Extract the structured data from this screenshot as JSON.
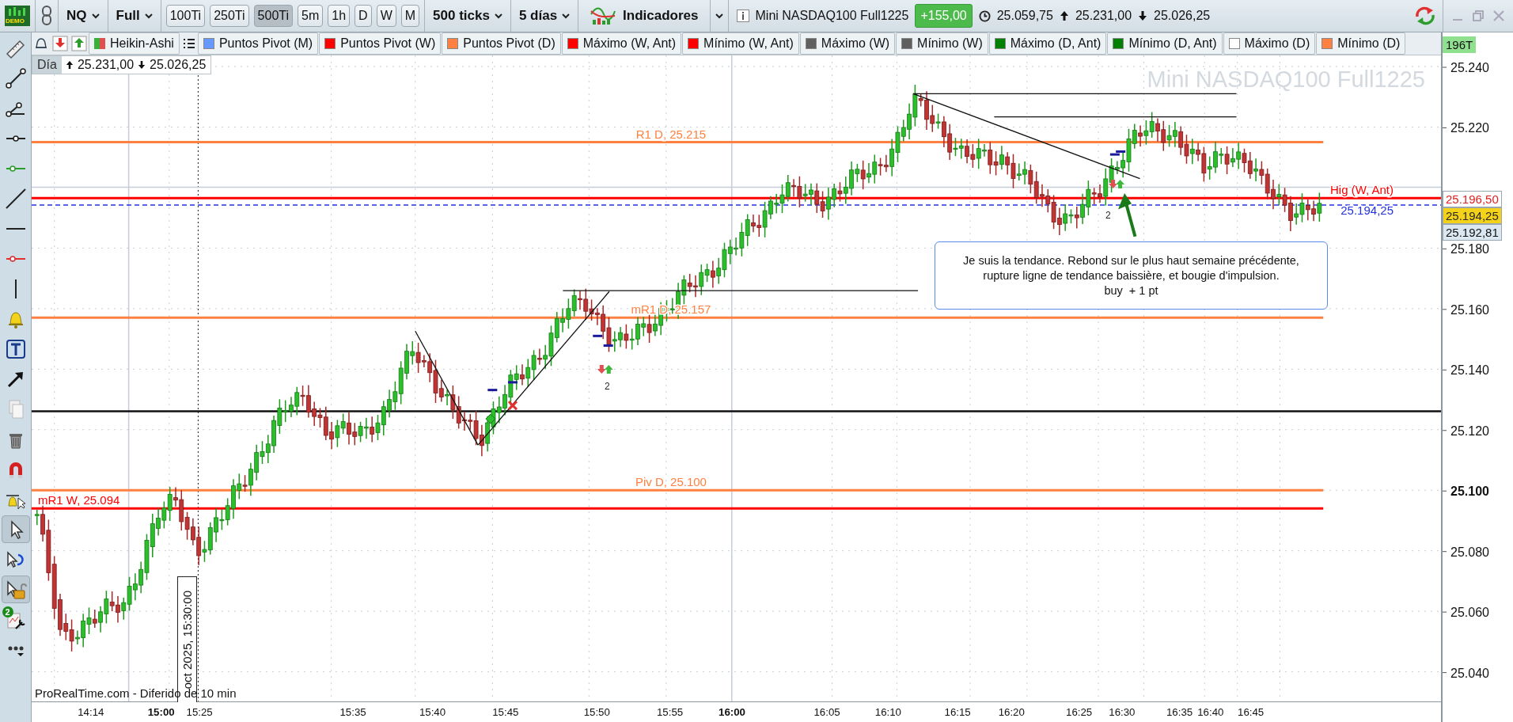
{
  "toolbar": {
    "logo": "DEMO",
    "symbol": "NQ",
    "mode": "Full",
    "intervals": [
      {
        "label": "100Ti",
        "selected": false
      },
      {
        "label": "250Ti",
        "selected": false
      },
      {
        "label": "500Ti",
        "selected": true
      },
      {
        "label": "5m",
        "selected": false
      },
      {
        "label": "1h",
        "selected": false
      },
      {
        "label": "D",
        "selected": false
      },
      {
        "label": "W",
        "selected": false
      },
      {
        "label": "M",
        "selected": false
      }
    ],
    "ticks": "500 ticks",
    "period": "5 días",
    "indicators": "Indicadores",
    "instrument": "Mini NASDAQ100 Full1225",
    "change": "+155,00",
    "last": "25.059,75",
    "high": "25.231,00",
    "low": "25.026,25"
  },
  "legend": {
    "items": [
      {
        "label": "Heikin-Ashi",
        "kind": "heikin"
      },
      {
        "label": "Puntos Pivot (M)",
        "kind": "swatch",
        "color": "#6699ff"
      },
      {
        "label": "Puntos Pivot (W)",
        "kind": "swatch",
        "color": "#ff0000"
      },
      {
        "label": "Puntos Pivot (D)",
        "kind": "swatch",
        "color": "#ff8040"
      },
      {
        "label": "Máximo (W, Ant)",
        "kind": "swatch",
        "color": "#ff0000"
      },
      {
        "label": "Mínimo (W, Ant)",
        "kind": "swatch",
        "color": "#ff0000"
      },
      {
        "label": "Máximo (W)",
        "kind": "swatch",
        "color": "#606060"
      },
      {
        "label": "Mínimo (W)",
        "kind": "swatch",
        "color": "#606060"
      },
      {
        "label": "Máximo (D, Ant)",
        "kind": "swatch",
        "color": "#008000"
      },
      {
        "label": "Mínimo (D, Ant)",
        "kind": "swatch",
        "color": "#008000"
      },
      {
        "label": "Máximo (D)",
        "kind": "swatch",
        "color": "#ffffff"
      },
      {
        "label": "Mínimo (D)",
        "kind": "swatch",
        "color": "#ff8040"
      }
    ],
    "bar_count": "196T"
  },
  "sidebar": {
    "tools": [
      {
        "kind": "ruler",
        "selected": false
      },
      {
        "kind": "segment",
        "selected": false
      },
      {
        "kind": "ray",
        "selected": false
      },
      {
        "kind": "hdot",
        "selected": false
      },
      {
        "kind": "hgreen",
        "selected": false
      },
      {
        "kind": "line",
        "selected": false
      },
      {
        "kind": "hline",
        "selected": false
      },
      {
        "kind": "hred",
        "selected": false
      },
      {
        "kind": "vline",
        "selected": false
      },
      {
        "kind": "bell",
        "selected": false
      },
      {
        "kind": "text",
        "selected": false
      },
      {
        "kind": "arrow",
        "selected": false
      },
      {
        "kind": "copy",
        "selected": false
      },
      {
        "kind": "trash",
        "selected": false
      },
      {
        "kind": "magnet",
        "selected": false
      },
      {
        "kind": "bellcursor",
        "selected": false
      },
      {
        "kind": "pointer",
        "selected": true
      },
      {
        "kind": "rotate",
        "selected": false
      },
      {
        "kind": "lock",
        "selected": true
      },
      {
        "kind": "wrench",
        "selected": false,
        "badge": "2"
      },
      {
        "kind": "more",
        "selected": false
      }
    ]
  },
  "chart": {
    "day_label": "Día",
    "day_high": "25.231,00",
    "day_low": "25.026,25",
    "watermark": "Mini NASDAQ100 Full1225",
    "levels": [
      {
        "label": "R1 D, 25.215",
        "color": "#ff8040",
        "kind": "pivot"
      },
      {
        "label": "Hig (W, Ant)",
        "color": "#ff0000",
        "kind": "high"
      },
      {
        "label": "25.194,25",
        "color": "#2233dd",
        "kind": "current"
      },
      {
        "label": "mR1 D, 25.157",
        "color": "#ff8040",
        "kind": "pivot"
      },
      {
        "label": "Piv D, 25.100",
        "color": "#ff8040",
        "kind": "pivot"
      },
      {
        "label": "mR1 W, 25.094",
        "color": "#ff0000",
        "kind": "weekly"
      }
    ],
    "price_tags": [
      {
        "label": "25.196,50",
        "kind": "high"
      },
      {
        "label": "25.194,25",
        "kind": "level"
      },
      {
        "label": "25.192,81",
        "kind": "last"
      }
    ],
    "yticks": [
      {
        "label": "25.240",
        "bold": false
      },
      {
        "label": "25.220",
        "bold": false
      },
      {
        "label": "25.180",
        "bold": false
      },
      {
        "label": "25.160",
        "bold": false
      },
      {
        "label": "25.140",
        "bold": false
      },
      {
        "label": "25.120",
        "bold": false
      },
      {
        "label": "25.100",
        "bold": true
      },
      {
        "label": "25.080",
        "bold": false
      },
      {
        "label": "25.060",
        "bold": false
      },
      {
        "label": "25.040",
        "bold": false
      }
    ],
    "xticks": [
      {
        "label": "14:14",
        "bold": false
      },
      {
        "label": "15:00",
        "bold": true
      },
      {
        "label": "15:25",
        "bold": false
      },
      {
        "label": "15:35",
        "bold": false
      },
      {
        "label": "15:40",
        "bold": false
      },
      {
        "label": "15:45",
        "bold": false
      },
      {
        "label": "15:50",
        "bold": false
      },
      {
        "label": "15:55",
        "bold": false
      },
      {
        "label": "16:00",
        "bold": true
      },
      {
        "label": "16:05",
        "bold": false
      },
      {
        "label": "16:10",
        "bold": false
      },
      {
        "label": "16:15",
        "bold": false
      },
      {
        "label": "16:20",
        "bold": false
      },
      {
        "label": "16:25",
        "bold": false
      },
      {
        "label": "16:30",
        "bold": false
      },
      {
        "label": "16:35",
        "bold": false
      },
      {
        "label": "16:40",
        "bold": false
      },
      {
        "label": "16:45",
        "bold": false
      }
    ],
    "cursor_time": "oct 2025, 15:30:00",
    "markers": [
      {
        "text": "2"
      },
      {
        "text": "2"
      }
    ],
    "note": [
      "Je suis la tendance. Rebond sur le plus haut semaine précédente,",
      "rupture ligne de tendance baissière, et bougie d'impulsion.",
      "buy  + 1 pt"
    ],
    "source": "ProRealTime.com - Diferido de 10 min"
  }
}
